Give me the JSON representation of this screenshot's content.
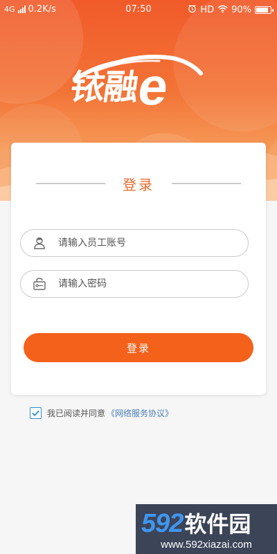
{
  "status_bar": {
    "network": "4G",
    "speed": "0.2K/s",
    "time": "07:50",
    "hd": "HD",
    "battery": "90%",
    "battery_level": 0.9
  },
  "logo": {
    "text_cn": "铱融",
    "text_e": "e"
  },
  "login_card": {
    "title": "登录",
    "username_placeholder": "请输入员工账号",
    "username_value": "",
    "password_placeholder": "请输入密码",
    "password_value": "",
    "submit_label": "登录"
  },
  "agreement": {
    "checked": true,
    "text": "我已阅读并同意",
    "link": "《网络服务协议》"
  },
  "watermark": {
    "brand_number": "592",
    "brand_cn": "软件园",
    "url": "www.592xiazai.com"
  },
  "colors": {
    "header_top": "#f15a2a",
    "accent": "#f4611b",
    "title": "#e66a2a",
    "checkbox": "#2c8fd0",
    "link": "#4a7fb8"
  },
  "icons": {
    "username": "user-icon",
    "password": "key-icon",
    "checkbox": "checkmark-icon",
    "wifi": "wifi-icon",
    "alarm": "alarm-clock-icon"
  }
}
